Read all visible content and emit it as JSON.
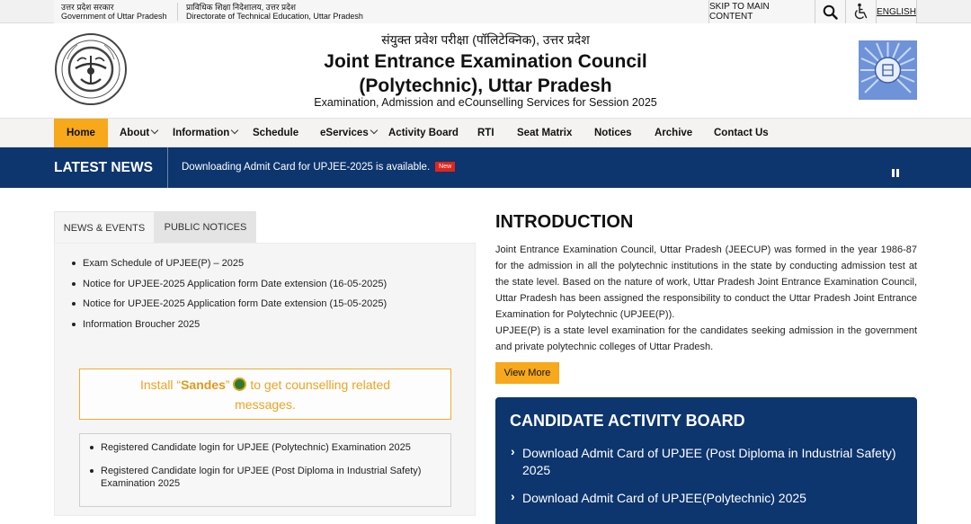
{
  "topbar": {
    "gov_hindi": "उत्तर प्रदेश सरकार",
    "gov_english": "Government of Uttar Pradesh",
    "dept_hindi": "प्राविधिक शिक्षा निदेशालय, उत्तर प्रदेश",
    "dept_english": "Directorate of Technical Education, Uttar Pradesh",
    "skip_label": "SKIP TO MAIN CONTENT",
    "search_icon": "search-icon",
    "accessibility_icon": "accessibility-icon",
    "language_label": "ENGLISH"
  },
  "header": {
    "hindi_title": "संयुक्त प्रवेश परीक्षा (पॉलिटेक्निक), उत्तर प्रदेश",
    "title_line1": "Joint Entrance Examination Council",
    "title_line2": "(Polytechnic), Uttar Pradesh",
    "subtitle": "Examination, Admission and eCounselling Services for Session 2025"
  },
  "nav": {
    "items": [
      {
        "label": "Home",
        "active": true
      },
      {
        "label": "About",
        "dropdown": true
      },
      {
        "label": "Information",
        "dropdown": true
      },
      {
        "label": "Schedule"
      },
      {
        "label": "eServices",
        "dropdown": true
      },
      {
        "label": "Activity Board"
      },
      {
        "label": "RTI"
      },
      {
        "label": "Seat Matrix"
      },
      {
        "label": "Notices"
      },
      {
        "label": "Archive"
      },
      {
        "label": "Contact Us"
      }
    ]
  },
  "latest_news": {
    "label": "LATEST NEWS",
    "text": "Downloading Admit Card for UPJEE-2025 is available.",
    "badge": "New"
  },
  "left_panel": {
    "tabs": [
      "NEWS & EVENTS",
      "PUBLIC NOTICES"
    ],
    "news_items": [
      "Exam Schedule of UPJEE(P) – 2025",
      "Notice for UPJEE-2025 Application form Date extension (16-05-2025)",
      "Notice for UPJEE-2025 Application form Date extension (15-05-2025)",
      "Information Broucher 2025"
    ],
    "sandes": {
      "prefix": "Install “",
      "app_name": "Sandes",
      "mid": "” ",
      "suffix": " to get counselling related",
      "line2": "messages."
    },
    "candidate_links": [
      "Registered Candidate login for UPJEE (Polytechnic) Examination 2025",
      "Registered Candidate login for UPJEE (Post Diploma in Industrial Safety) Examination 2025"
    ]
  },
  "intro": {
    "title": "INTRODUCTION",
    "para1": "Joint Entrance Examination Council, Uttar Pradesh (JEECUP) was formed in the year 1986-87 for the admission in all the polytechnic institutions in the state by conducting admission test at the state level. Based on the nature of work, Uttar Pradesh Joint Entrance Examination Council, Uttar Pradesh has been assigned the responsibility to conduct the Uttar Pradesh Joint Entrance Examination for Polytechnic (UPJEE(P)).",
    "para2": "UPJEE(P) is a state level examination for the candidates seeking admission in the government and private polytechnic colleges of Uttar Pradesh.",
    "view_more": "View More"
  },
  "activity_board": {
    "title": "CANDIDATE ACTIVITY BOARD",
    "items": [
      "Download Admit Card of UPJEE (Post Diploma in Industrial Safety) 2025",
      "Download Admit Card of UPJEE(Polytechnic) 2025"
    ]
  },
  "colors": {
    "accent": "#f7a81b",
    "navy": "#0d356e",
    "new_badge": "#e1251b"
  }
}
